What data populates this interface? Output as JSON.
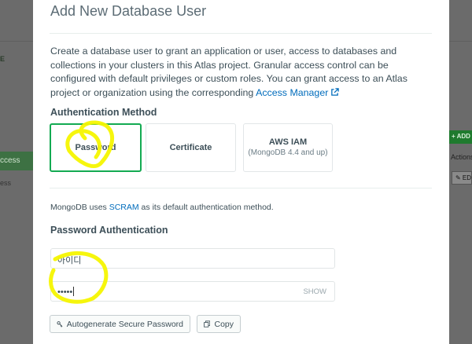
{
  "background": {
    "left_item_partial": "E",
    "left_active_partial": "ccess",
    "left_item2_partial": "ess",
    "right_add_partial": "+ ADD N",
    "right_actions_partial": "Actions",
    "right_edit_partial": "✎ EDI"
  },
  "modal": {
    "title": "Add New Database User",
    "description_text": "Create a database user to grant an application or user, access to databases and collections in your clusters in this Atlas project. Granular access control can be configured with default privileges or custom roles. You can grant access to an Atlas project or organization using the corresponding ",
    "description_link": "Access Manager",
    "auth_method_title": "Authentication Method",
    "auth_methods": [
      {
        "label": "Password",
        "sub": ""
      },
      {
        "label": "Certificate",
        "sub": ""
      },
      {
        "label": "AWS IAM",
        "sub": "(MongoDB 4.4 and up)"
      }
    ],
    "scram_prefix": "MongoDB uses ",
    "scram_link": "SCRAM",
    "scram_suffix": " as its default authentication method.",
    "password_auth_title": "Password Authentication",
    "username_value": "아이디",
    "password_value": "•••••",
    "show_label": "SHOW",
    "autogen_label": "Autogenerate Secure Password",
    "copy_label": "Copy"
  },
  "colors": {
    "accent_green": "#13aa52",
    "link_blue": "#006cbc",
    "highlighter_yellow": "#f5f500"
  }
}
